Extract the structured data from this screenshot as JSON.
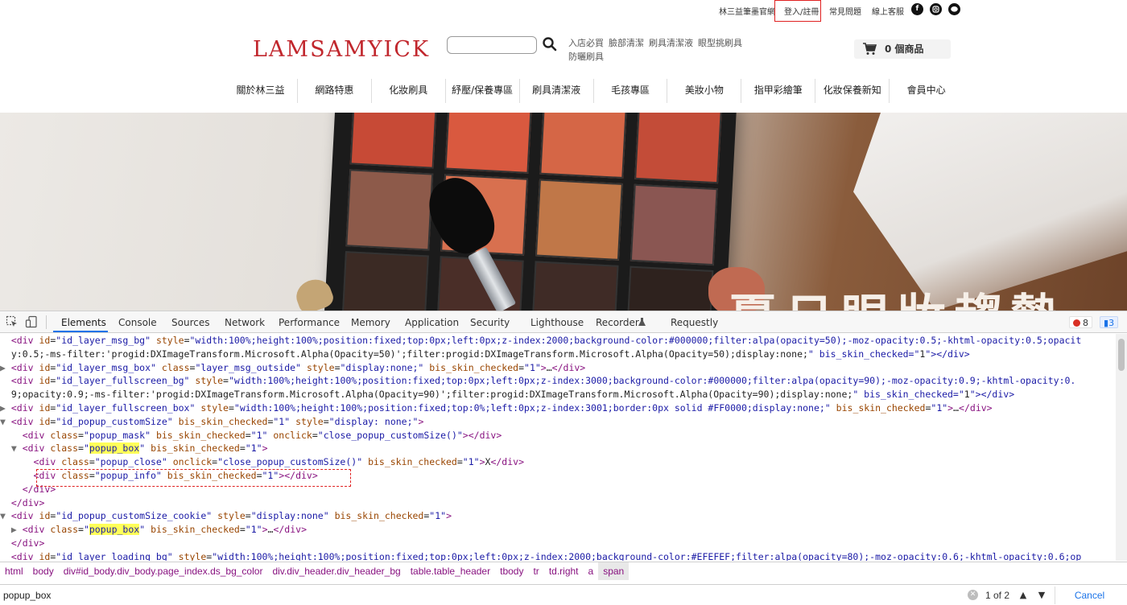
{
  "site": {
    "top_links": [
      "林三益筆墨官網",
      "登入/註冊",
      "常見問題",
      "線上客服"
    ],
    "logo": "LAMSAMYICK",
    "quick_links": [
      "入店必買",
      "臉部清潔",
      "刷具清潔液",
      "眼型挑刷具",
      "防曬刷具"
    ],
    "cart_label": "0 個商品",
    "nav": [
      "關於林三益",
      "網路特惠",
      "化妝刷具",
      "紓壓/保養專區",
      "刷具清潔液",
      "毛孩專區",
      "美妝小物",
      "指甲彩繪筆",
      "化妝保養新知",
      "會員中心"
    ],
    "hero_text": "夏日眼妝趨勢"
  },
  "devtools": {
    "tabs": [
      "Elements",
      "Console",
      "Sources",
      "Network",
      "Performance",
      "Memory",
      "Application",
      "Security",
      "Lighthouse",
      "Recorder",
      "Requestly"
    ],
    "active_tab": "Elements",
    "error_count": "8",
    "message_count": "3",
    "breadcrumbs": [
      "html",
      "body",
      "div#id_body.div_body.page_index.ds_bg_color",
      "div.div_header.div_header_bg",
      "table.table_header",
      "tbody",
      "tr",
      "td.right",
      "a",
      "span"
    ],
    "search_value": "popup_box",
    "match_count": "1 of 2",
    "cancel_label": "Cancel",
    "code_lines": [
      "  <div id=\"id_layer_msg_bg\" style=\"width:100%;height:100%;position:fixed;top:0px;left:0px;z-index:2000;background-color:#000000;filter:alpa(opacity=50);-moz-opacity:0.5;-khtml-opacity:0.5;opacit",
      "  y:0.5;-ms-filter:'progid:DXImageTransform.Microsoft.Alpha(Opacity=50)';filter:progid:DXImageTransform.Microsoft.Alpha(Opacity=50);display:none;\" bis_skin_checked=\"1\"></div>",
      "▶ <div id=\"id_layer_msg_box\" class=\"layer_msg_outside\" style=\"display:none;\" bis_skin_checked=\"1\">…</div>",
      "  <div id=\"id_layer_fullscreen_bg\" style=\"width:100%;height:100%;position:fixed;top:0px;left:0px;z-index:3000;background-color:#000000;filter:alpa(opacity=90);-moz-opacity:0.9;-khtml-opacity:0.",
      "  9;opacity:0.9;-ms-filter:'progid:DXImageTransform.Microsoft.Alpha(Opacity=90)';filter:progid:DXImageTransform.Microsoft.Alpha(Opacity=90);display:none;\" bis_skin_checked=\"1\"></div>",
      "▶ <div id=\"id_layer_fullscreen_box\" style=\"width:100%;height:100%;position:fixed;top:0%;left:0px;z-index:3001;border:0px solid #FF0000;display:none;\" bis_skin_checked=\"1\">…</div>",
      "▼ <div id=\"id_popup_customSize\" bis_skin_checked=\"1\" style=\"display: none;\">",
      "    <div class=\"popup_mask\" bis_skin_checked=\"1\" onclick=\"close_popup_customSize()\"></div>",
      "  ▼ <div class=\"popup_box\" bis_skin_checked=\"1\">",
      "      <div class=\"popup_close\" onclick=\"close_popup_customSize()\" bis_skin_checked=\"1\">X</div>",
      "      <div class=\"popup_info\" bis_skin_checked=\"1\"></div>",
      "    </div>",
      "  </div>",
      "▼ <div id=\"id_popup_customSize_cookie\" style=\"display:none\" bis_skin_checked=\"1\">",
      "  ▶ <div class=\"popup_box\" bis_skin_checked=\"1\">…</div>",
      "  </div>",
      "  <div id=\"id_layer_loading_bg\" style=\"width:100%;height:100%;position:fixed;top:0px;left:0px;z-index:2000;background-color:#EFEFEF;filter:alpa(opacity=80);-moz-opacity:0.6;-khtml-opacity:0.6;op"
    ]
  }
}
